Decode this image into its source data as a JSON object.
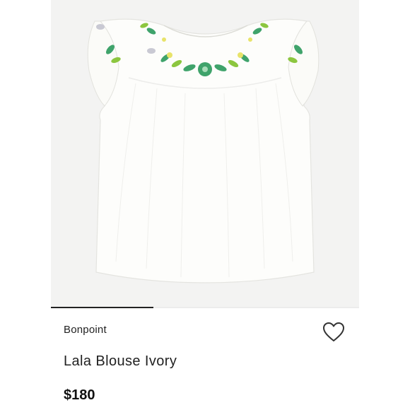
{
  "listing": {
    "brand": "Bonpoint",
    "title": "Lala Blouse Ivory",
    "price": "$180"
  },
  "gallery": {
    "slide_count": 3,
    "active_slide": 1
  },
  "icons": {
    "zoom": "zoom-in-icon",
    "like": "heart-icon"
  },
  "colors": {
    "image_background": "#f3f3f2",
    "garment": "#fdfdfb",
    "embroidery_green": "#3fa36b",
    "embroidery_leaf": "#8cc63f",
    "text": "#222222"
  }
}
